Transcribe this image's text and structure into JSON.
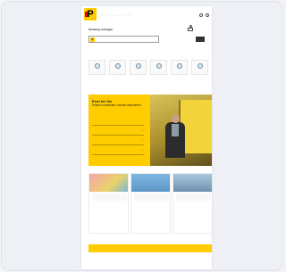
{
  "header": {
    "logo": "P",
    "top_links": [
      "",
      "",
      "",
      "",
      ""
    ],
    "nav": [
      "",
      "",
      "",
      "",
      "",
      ""
    ]
  },
  "search": {
    "title": "Sendung verfolgen",
    "placeholder": "",
    "button": ""
  },
  "tiles": [
    "",
    "",
    "",
    "",
    "",
    ""
  ],
  "tiles_more": "",
  "hero": {
    "title": "Post für Sie",
    "subtitle": "Einfach versenden, schnell ankommen",
    "links": [
      "",
      "",
      "",
      ""
    ]
  },
  "news": [
    {
      "title": ""
    },
    {
      "title": ""
    },
    {
      "title": ""
    }
  ],
  "footer": {
    "left": "",
    "right": "",
    "columns": [
      "",
      "",
      "",
      ""
    ]
  },
  "colors": {
    "brand_yellow": "#ffcc00",
    "brand_red": "#e2001a"
  }
}
